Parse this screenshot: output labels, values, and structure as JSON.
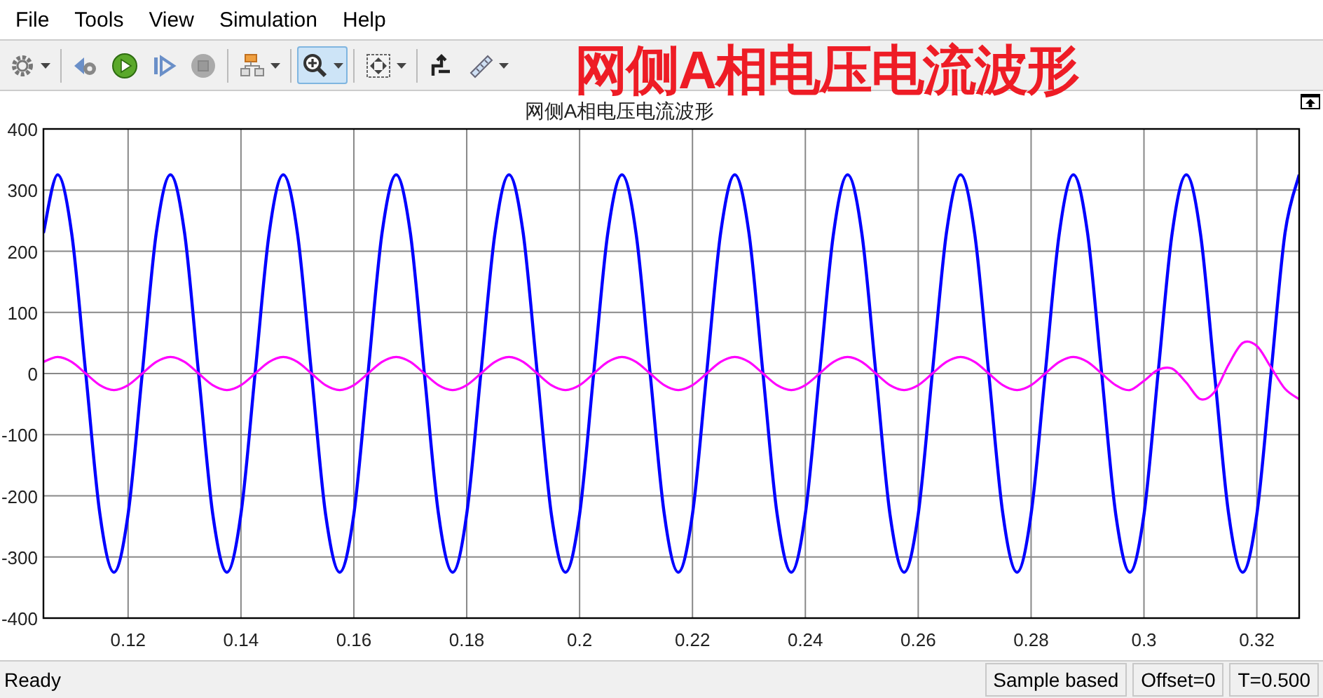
{
  "menu": [
    "File",
    "Tools",
    "View",
    "Simulation",
    "Help"
  ],
  "toolbar": [
    [
      {
        "kind": "settings",
        "dropdown": true,
        "selected": false
      }
    ],
    [
      {
        "kind": "step-back",
        "dropdown": false,
        "selected": false
      },
      {
        "kind": "run",
        "dropdown": false,
        "selected": false
      },
      {
        "kind": "step-forward",
        "dropdown": false,
        "selected": false
      },
      {
        "kind": "stop",
        "dropdown": false,
        "selected": false
      }
    ],
    [
      {
        "kind": "highlight",
        "dropdown": true,
        "selected": false
      }
    ],
    [
      {
        "kind": "zoom",
        "dropdown": true,
        "selected": true
      }
    ],
    [
      {
        "kind": "fit",
        "dropdown": true,
        "selected": false
      }
    ],
    [
      {
        "kind": "trigger",
        "dropdown": false,
        "selected": false
      },
      {
        "kind": "measure",
        "dropdown": true,
        "selected": false
      }
    ]
  ],
  "caption_overlay": "网侧A相电压电流波形",
  "plot": {
    "title": "网侧A相电压电流波形",
    "chart_data": {
      "type": "line",
      "grid": true,
      "xlim": [
        0.105,
        0.3275
      ],
      "ylim": [
        -400,
        400
      ],
      "xticks": [
        0.12,
        0.14,
        0.16,
        0.18,
        0.2,
        0.22,
        0.24,
        0.26,
        0.28,
        0.3,
        0.32
      ],
      "yticks": [
        -400,
        -300,
        -200,
        -100,
        0,
        100,
        200,
        300,
        400
      ],
      "x": [
        0.105,
        0.1075,
        0.11,
        0.1125,
        0.115,
        0.1175,
        0.12,
        0.1225,
        0.125,
        0.1275,
        0.13,
        0.1325,
        0.135,
        0.1375,
        0.14,
        0.1425,
        0.145,
        0.1475,
        0.15,
        0.1525,
        0.155,
        0.1575,
        0.16,
        0.1625,
        0.165,
        0.1675,
        0.17,
        0.1725,
        0.175,
        0.1775,
        0.18,
        0.1825,
        0.185,
        0.1875,
        0.19,
        0.1925,
        0.195,
        0.1975,
        0.2,
        0.2025,
        0.205,
        0.2075,
        0.21,
        0.2125,
        0.215,
        0.2175,
        0.22,
        0.2225,
        0.225,
        0.2275,
        0.23,
        0.2325,
        0.235,
        0.2375,
        0.24,
        0.2425,
        0.245,
        0.2475,
        0.25,
        0.2525,
        0.255,
        0.2575,
        0.26,
        0.2625,
        0.265,
        0.2675,
        0.27,
        0.2725,
        0.275,
        0.2775,
        0.28,
        0.2825,
        0.285,
        0.2875,
        0.29,
        0.2925,
        0.295,
        0.2975,
        0.3,
        0.3025,
        0.305,
        0.3075,
        0.31,
        0.3125,
        0.315,
        0.3175,
        0.32,
        0.3225,
        0.325,
        0.3275
      ],
      "series": [
        {
          "color": "#0000ff",
          "values": [
            230,
            325,
            230,
            0,
            -230,
            -325,
            -230,
            0,
            230,
            325,
            230,
            0,
            -230,
            -325,
            -230,
            0,
            230,
            325,
            230,
            0,
            -230,
            -325,
            -230,
            0,
            230,
            325,
            230,
            0,
            -230,
            -325,
            -230,
            0,
            230,
            325,
            230,
            0,
            -230,
            -325,
            -230,
            0,
            230,
            325,
            230,
            0,
            -230,
            -325,
            -230,
            0,
            230,
            325,
            230,
            0,
            -230,
            -325,
            -230,
            0,
            230,
            325,
            230,
            0,
            -230,
            -325,
            -230,
            0,
            230,
            325,
            230,
            0,
            -230,
            -325,
            -230,
            0,
            230,
            325,
            230,
            0,
            -230,
            -325,
            -230,
            0,
            230,
            325,
            230,
            0,
            -230,
            -325,
            -230,
            0,
            230,
            325
          ]
        },
        {
          "color": "#ff00ff",
          "values": [
            19,
            27,
            19,
            0,
            -19,
            -27,
            -19,
            0,
            19,
            27,
            19,
            0,
            -19,
            -27,
            -19,
            0,
            19,
            27,
            19,
            0,
            -19,
            -27,
            -19,
            0,
            19,
            27,
            19,
            0,
            -19,
            -27,
            -19,
            0,
            19,
            27,
            19,
            0,
            -19,
            -27,
            -19,
            0,
            19,
            27,
            19,
            0,
            -19,
            -27,
            -19,
            0,
            19,
            27,
            19,
            0,
            -19,
            -27,
            -19,
            0,
            19,
            27,
            19,
            0,
            -19,
            -27,
            -19,
            0,
            19,
            27,
            19,
            0,
            -19,
            -27,
            -19,
            0,
            19,
            27,
            19,
            0,
            -19,
            -27,
            -12,
            6,
            8,
            -15,
            -42,
            -30,
            15,
            50,
            45,
            10,
            -25,
            -42
          ]
        }
      ]
    }
  },
  "status_bar": {
    "message": "Ready",
    "fields": [
      "Sample based",
      "Offset=0",
      "T=0.500"
    ]
  }
}
